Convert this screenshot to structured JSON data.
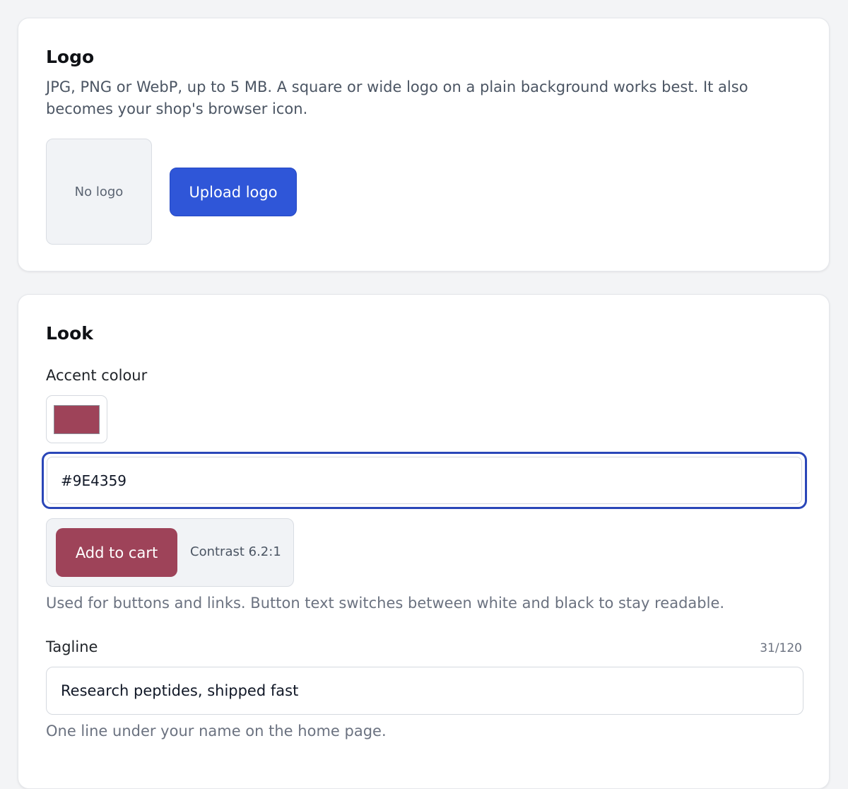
{
  "logo_section": {
    "title": "Logo",
    "description": "JPG, PNG or WebP, up to 5 MB. A square or wide logo on a plain background works best. It also becomes your shop's browser icon.",
    "placeholder_text": "No logo",
    "upload_button_label": "Upload logo"
  },
  "look_section": {
    "title": "Look",
    "accent": {
      "label": "Accent colour",
      "swatch_color": "#9E4359",
      "hex_value": "#9E4359",
      "preview_button_label": "Add to cart",
      "contrast_text": "Contrast 6.2:1",
      "help_text": "Used for buttons and links. Button text switches between white and black to stay readable."
    },
    "tagline": {
      "label": "Tagline",
      "counter": "31/120",
      "value": "Research peptides, shipped fast",
      "help_text": "One line under your name on the home page."
    }
  },
  "colors": {
    "primary_button": "#2f56d8",
    "focus_ring": "#2a46b8",
    "accent": "#9E4359"
  }
}
